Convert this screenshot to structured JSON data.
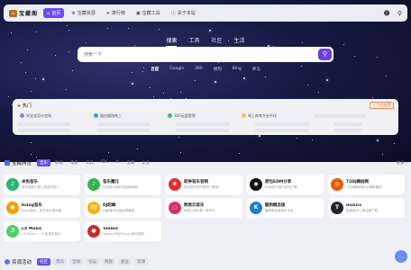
{
  "brand": {
    "logo_text": "宝藏阁",
    "logo_mark": "⌂"
  },
  "nav": {
    "items": [
      {
        "label": "首页",
        "icon": "home-icon",
        "glyph": "⌂",
        "active": true
      },
      {
        "label": "宝藏资源",
        "icon": "gear-icon",
        "glyph": "⚙",
        "active": false
      },
      {
        "label": "排行榜",
        "icon": "ranking-icon",
        "glyph": "≡",
        "active": false
      },
      {
        "label": "宝藏工具",
        "icon": "tools-icon",
        "glyph": "▣",
        "active": false
      },
      {
        "label": "关于本站",
        "icon": "info-icon",
        "glyph": "ⓘ",
        "active": false
      }
    ],
    "user_icon": "user-icon",
    "search_icon": "search-icon"
  },
  "search": {
    "tabs": [
      "搜索",
      "工具",
      "社区",
      "生活"
    ],
    "active_tab": "搜索",
    "placeholder": "搜索一下",
    "engines": [
      "百度",
      "Google",
      "360",
      "搜狗",
      "Bing",
      "神马"
    ],
    "active_engine": "百度"
  },
  "hot": {
    "title": "热门",
    "more_label": "↓ 为你推荐",
    "items": [
      {
        "label": "米宝宝设计会场",
        "color": "#8f7cf5"
      },
      {
        "label": "路由器指南三",
        "color": "#5b8df2"
      },
      {
        "label": "360云盘管理",
        "color": "#35c27b"
      },
      {
        "label": "网上库库开启不佳",
        "color": "#f2c94c"
      }
    ]
  },
  "sites": {
    "title": "宝藏网址",
    "more_label": "更多 ›",
    "categories": [
      "音乐",
      "影视",
      "电影",
      "工具",
      "IDC",
      "AI",
      "宝藏",
      "企业"
    ],
    "active_category": "音乐",
    "cards": [
      {
        "title": "米免音乐",
        "desc": "音乐搜索下载工具密写统一",
        "color": "#2bb673",
        "glyph": "♫"
      },
      {
        "title": "音乐魔元",
        "desc": "在线音乐库收录各种风格",
        "color": "#37b24d",
        "glyph": "♪"
      },
      {
        "title": "彩钟音乐官网",
        "desc": "彩钟音乐排行榜热门歌曲",
        "color": "#e03131",
        "glyph": "❀"
      },
      {
        "title": "原包EDM分享",
        "desc": "EDM电子音乐总站下载",
        "color": "#111111",
        "glyph": "◉"
      },
      {
        "title": "72DJ舞曲网",
        "desc": "72DJ舞曲网北京最新舞曲",
        "color": "#e8590c",
        "glyph": "◎"
      },
      {
        "title": "bsing音乐",
        "desc": "bsing音乐，数字音乐库封面",
        "color": "#f59f00",
        "glyph": "●"
      },
      {
        "title": "DJ起峰",
        "desc": "DJ起峰专业高品质舞曲",
        "color": "#fab005",
        "glyph": "DJ"
      },
      {
        "title": "网易云音乐",
        "desc": "网易云音乐是一款专注",
        "color": "#d6336c",
        "glyph": "◌"
      },
      {
        "title": "酷狗概念版",
        "desc": "酷狗概念版音乐平台",
        "color": "#1c7ed6",
        "glyph": "K"
      },
      {
        "title": "musicc",
        "desc": "免费音乐工具合集下载",
        "color": "#212529",
        "glyph": "T"
      },
      {
        "title": "LX Music",
        "desc": "LX Music - 一个免费的音乐",
        "color": "#51cf66",
        "glyph": "♬"
      },
      {
        "title": "Teemic",
        "desc": "Teemic(听见Music)音乐搜索",
        "color": "#c92a2a",
        "glyph": "●"
      }
    ]
  },
  "resources": {
    "title": "资源活动",
    "tabs": [
      "社区",
      "资讯",
      "活动",
      "论坛",
      "网盘",
      "副业",
      "资源"
    ],
    "active_tab": "社区"
  },
  "chat_label": "…"
}
